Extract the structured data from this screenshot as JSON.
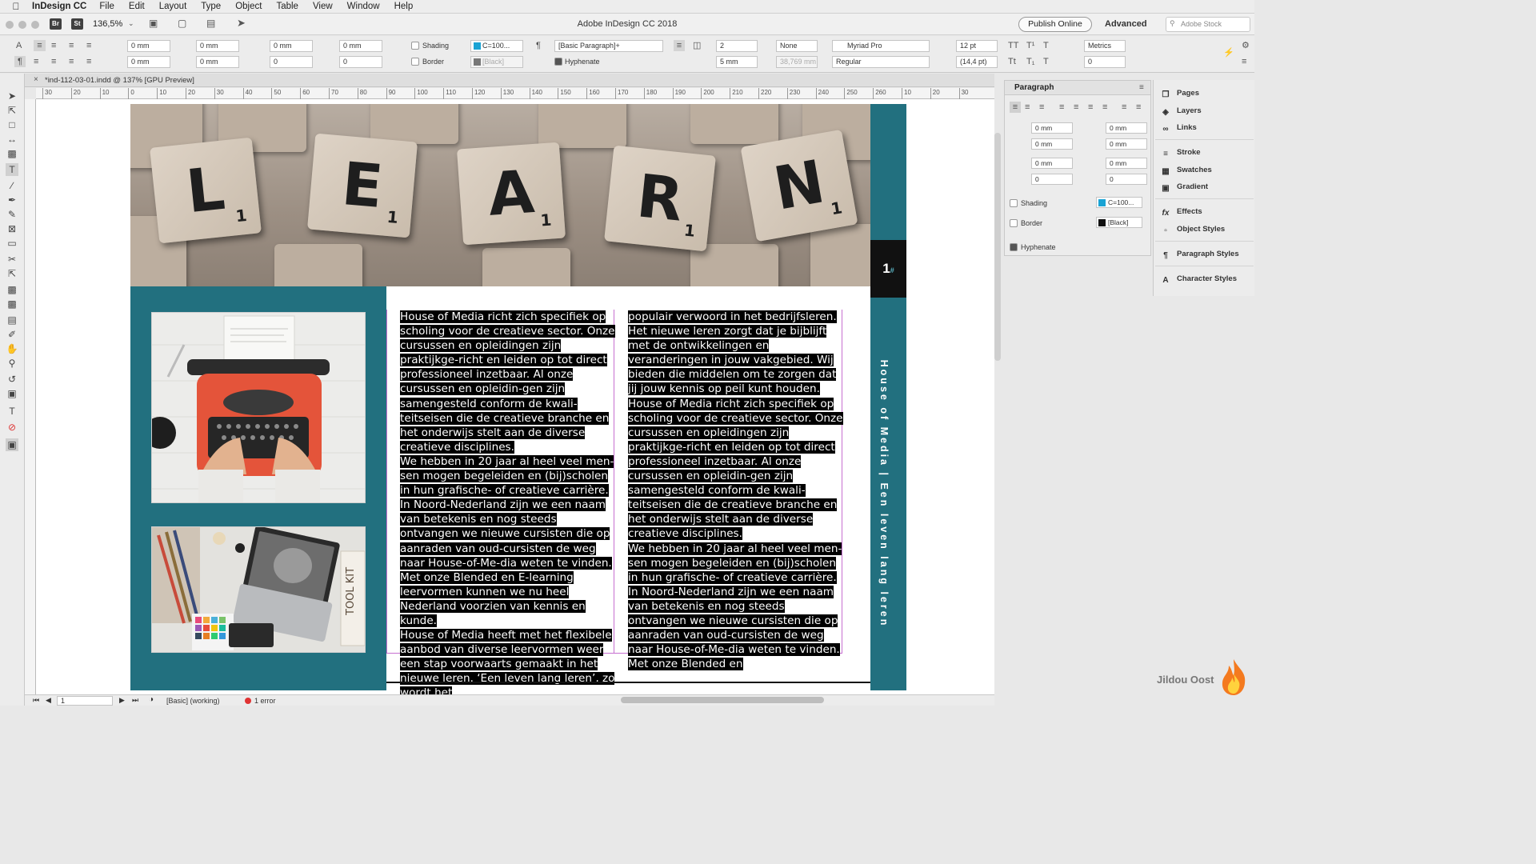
{
  "menubar": {
    "app_name": "InDesign CC",
    "items": [
      "File",
      "Edit",
      "Layout",
      "Type",
      "Object",
      "Table",
      "View",
      "Window",
      "Help"
    ]
  },
  "titlebar": {
    "zoom": "136,5%",
    "window_title": "Adobe InDesign CC 2018",
    "publish_label": "Publish Online",
    "workspace": "Advanced",
    "stock_placeholder": "Adobe Stock",
    "icon_br": "Br",
    "icon_st": "St"
  },
  "control": {
    "left_indent": "0 mm",
    "right_indent": "0 mm",
    "first_line_indent": "0 mm",
    "last_line_indent": "0 mm",
    "space_before": "0 mm",
    "space_after": "0 mm",
    "drop_cap_lines": "0",
    "drop_cap_chars": "0",
    "shading_label": "Shading",
    "shading_color": "C=100...",
    "border_label": "Border",
    "border_color": "[Black]",
    "paragraph_style": "[Basic Paragraph]+",
    "hyphenate_label": "Hyphenate",
    "columns": "2",
    "gutter": "5 mm",
    "span": "None",
    "column_width": "38,769 mm",
    "font_family": "Myriad Pro",
    "font_style": "Regular",
    "font_size": "12 pt",
    "leading": "(14,4 pt)",
    "kerning": "Metrics",
    "tracking": "0"
  },
  "document": {
    "tab_title": "*ind-112-03-01.indd @ 137% [GPU Preview]"
  },
  "ruler_h": [
    "30",
    "20",
    "10",
    "0",
    "10",
    "20",
    "30",
    "40",
    "50",
    "60",
    "70",
    "80",
    "90",
    "100",
    "110",
    "120",
    "130",
    "140",
    "150",
    "160",
    "170",
    "180",
    "190",
    "200",
    "210",
    "220",
    "230",
    "240",
    "250",
    "260",
    "10",
    "20",
    "30"
  ],
  "page": {
    "hero_letters": [
      "L",
      "E",
      "A",
      "R",
      "N"
    ],
    "hero_subscript": "1",
    "page_number": "1",
    "page_number_marker": "#",
    "vertical_text": "House of Media | Een leven lang leren",
    "colors": {
      "teal": "#22707f",
      "black_bar": "#111111"
    }
  },
  "column1": [
    "House of Media richt zich specifiek op scholing voor de creatieve sector. Onze cursussen en opleidingen zijn praktijkge-richt en leiden op tot direct professioneel inzetbaar. Al onze cursussen en opleidin-gen zijn samengesteld conform de kwali-teitseisen die de creatieve branche en het onderwijs stelt aan de diverse creatieve disciplines.",
    "We hebben in 20 jaar al heel veel men-sen mogen begeleiden en (bij)scholen in hun grafische- of creatieve carrière. In Noord-Nederland zijn we een naam van betekenis en nog steeds ontvangen we nieuwe cursisten die op aanraden van oud-cursisten de weg naar House-of-Me-dia weten te vinden. Met onze Blended en E-learning leervormen kunnen we nu heel Nederland voorzien van kennis en kunde.",
    "House of Media heeft met het flexibele aanbod van diverse leervormen weer een stap voorwaarts gemaakt in het nieuwe leren. ‘Een leven lang leren’, zo wordt het"
  ],
  "column2": [
    "populair verwoord in het bedrijfsleren. Het nieuwe leren zorgt dat je bijblijft met de ontwikkelingen en veranderingen in jouw vakgebied. Wij bieden die middelen om te zorgen dat jij jouw kennis op peil kunt houden.",
    "House of Media richt zich specifiek op scholing voor de creatieve sector. Onze cursussen en opleidingen zijn praktijkge-richt en leiden op tot direct professioneel inzetbaar. Al onze cursussen en opleidin-gen zijn samengesteld conform de kwali-teitseisen die de creatieve branche en het onderwijs stelt aan de diverse creatieve disciplines.",
    "We hebben in 20 jaar al heel veel men-sen mogen begeleiden en (bij)scholen in hun grafische- of creatieve carrière. In Noord-Nederland zijn we een naam van betekenis en nog steeds ontvangen we nieuwe cursisten die op aanraden van oud-cursisten de weg naar House-of-Me-dia weten te vinden. Met onze Blended en"
  ],
  "status": {
    "page": "1",
    "preflight_profile": "[Basic] (working)",
    "errors": "1 error"
  },
  "paragraph_panel": {
    "title": "Paragraph",
    "left_indent": "0 mm",
    "right_indent": "0 mm",
    "first_line": "0 mm",
    "last_line": "0 mm",
    "space_before": "0 mm",
    "space_after": "0 mm",
    "drop_lines": "0",
    "drop_chars": "0",
    "shading_label": "Shading",
    "shading_color": "C=100...",
    "border_label": "Border",
    "border_color": "[Black]",
    "hyphenate_label": "Hyphenate"
  },
  "dock": [
    {
      "label": "Pages",
      "icon": "pages-icon"
    },
    {
      "label": "Layers",
      "icon": "layers-icon"
    },
    {
      "label": "Links",
      "icon": "links-icon"
    },
    {
      "label": "Stroke",
      "icon": "stroke-icon"
    },
    {
      "label": "Swatches",
      "icon": "swatches-icon"
    },
    {
      "label": "Gradient",
      "icon": "gradient-icon"
    },
    {
      "label": "Effects",
      "icon": "effects-icon"
    },
    {
      "label": "Object Styles",
      "icon": "object-styles-icon"
    },
    {
      "label": "Paragraph Styles",
      "icon": "paragraph-styles-icon"
    },
    {
      "label": "Character Styles",
      "icon": "character-styles-icon"
    }
  ],
  "watermark": "Jildou Oost"
}
